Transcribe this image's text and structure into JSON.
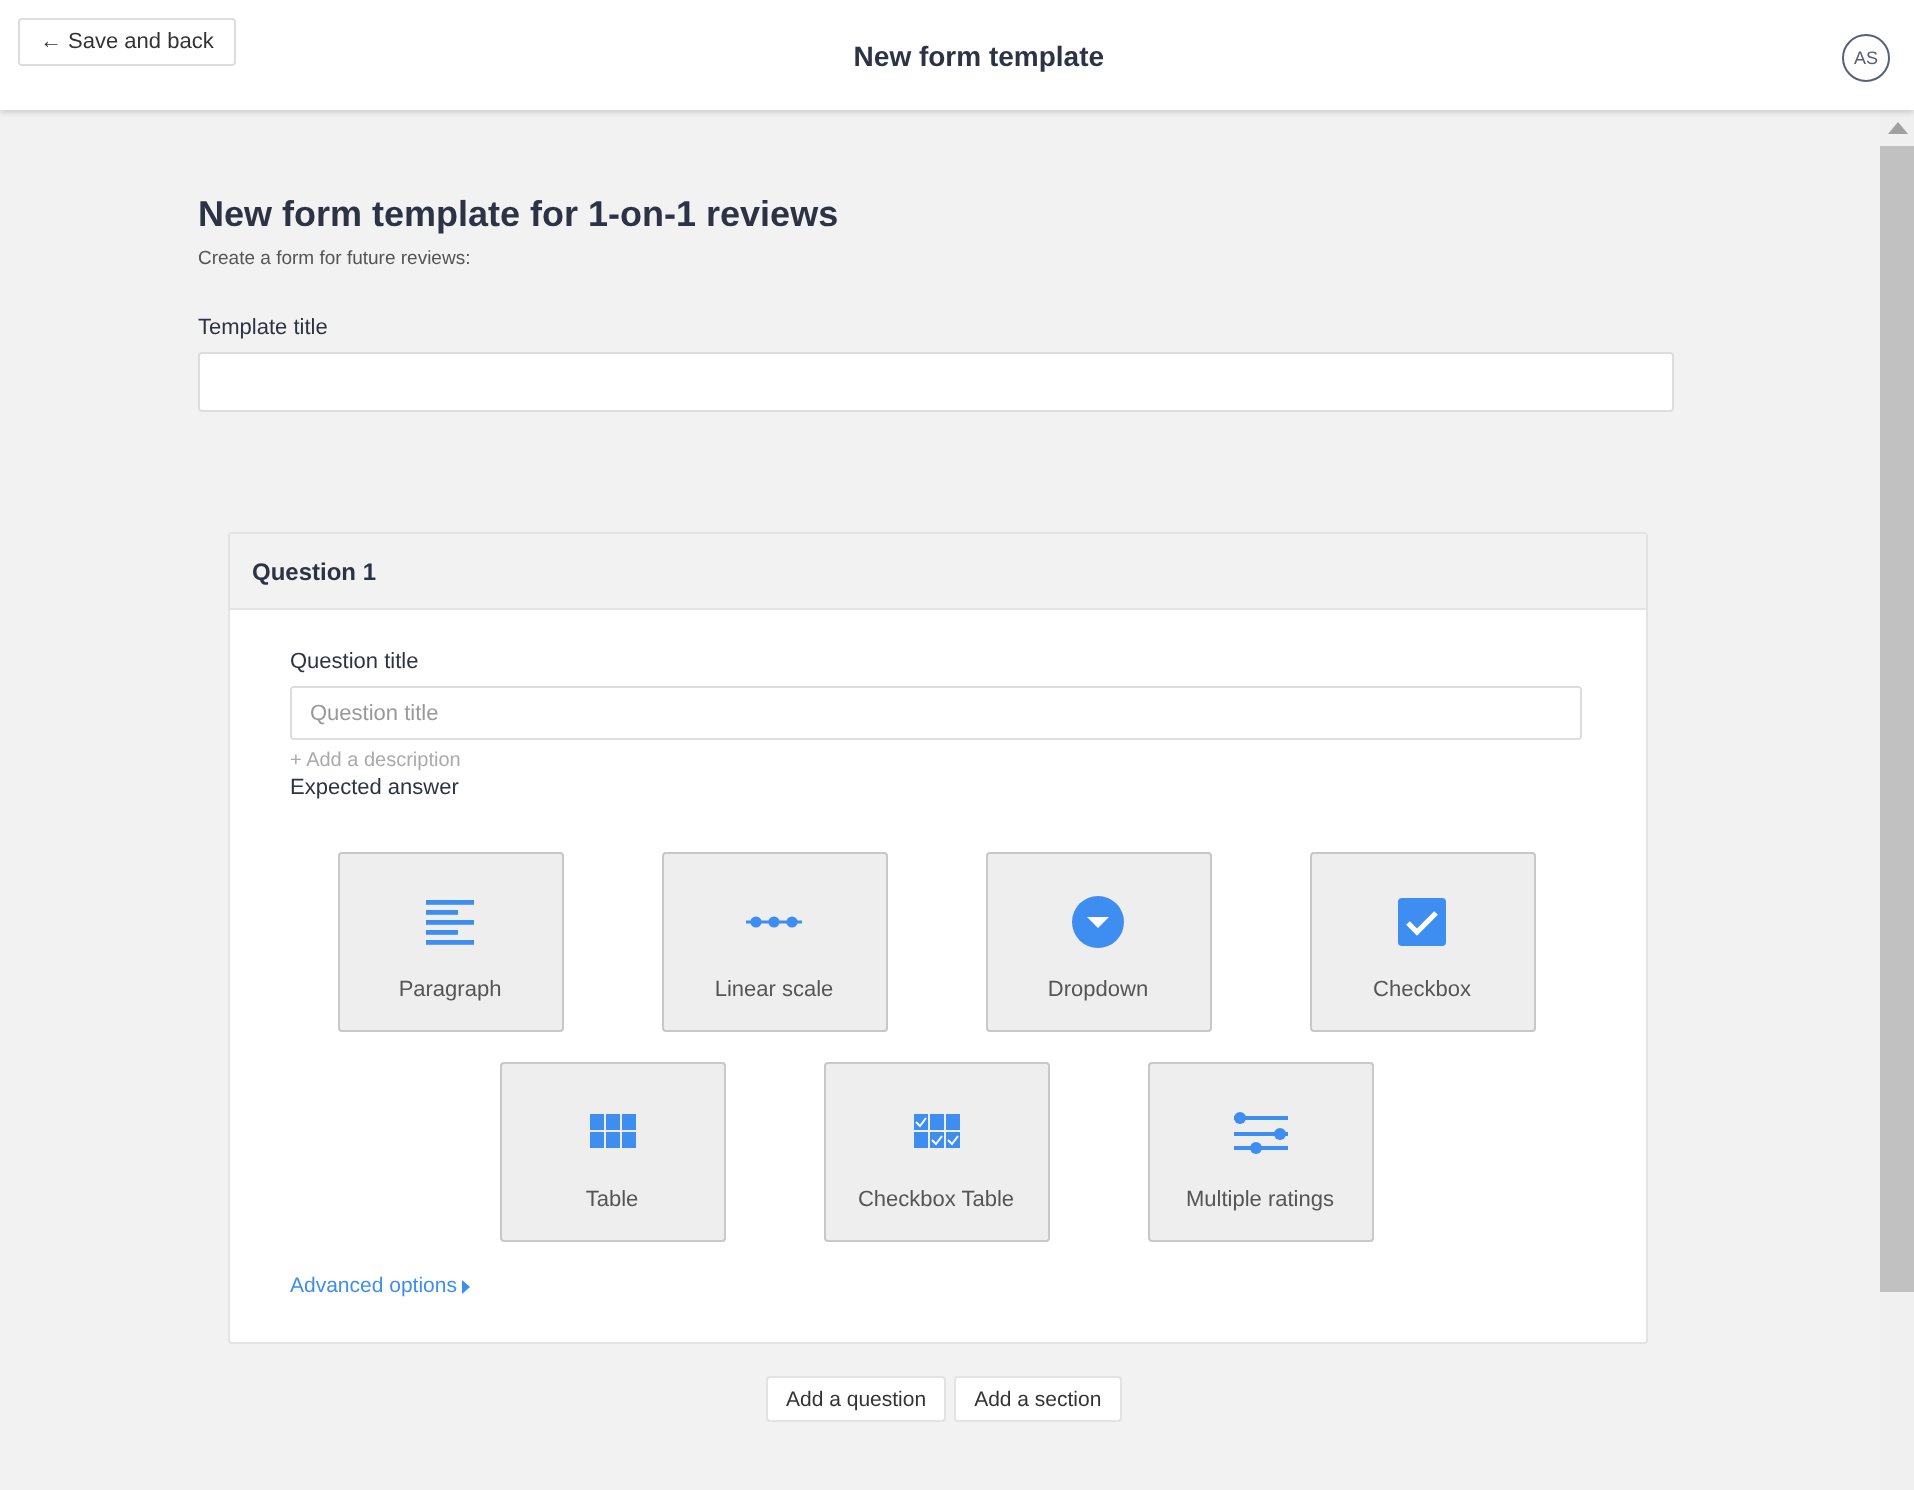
{
  "header": {
    "back_button": "← Save and back",
    "title": "New form template",
    "avatar": "AS"
  },
  "page": {
    "heading": "New form template for 1-on-1 reviews",
    "subtitle": "Create a form for future reviews:",
    "template_title_label": "Template title"
  },
  "question": {
    "title": "Question 1",
    "field_label": "Question title",
    "placeholder": "Question title",
    "add_description": "+ Add a description",
    "expected_answer_label": "Expected answer",
    "answer_types": [
      {
        "kind": "paragraph",
        "label": "Paragraph"
      },
      {
        "kind": "linear",
        "label": "Linear scale"
      },
      {
        "kind": "dropdown",
        "label": "Dropdown"
      },
      {
        "kind": "checkbox",
        "label": "Checkbox"
      },
      {
        "kind": "table",
        "label": "Table"
      },
      {
        "kind": "checkbox_table",
        "label": "Checkbox Table"
      },
      {
        "kind": "ratings",
        "label": "Multiple ratings"
      }
    ],
    "advanced_options": "Advanced options"
  },
  "actions": [
    "Add a question",
    "Add a section"
  ]
}
